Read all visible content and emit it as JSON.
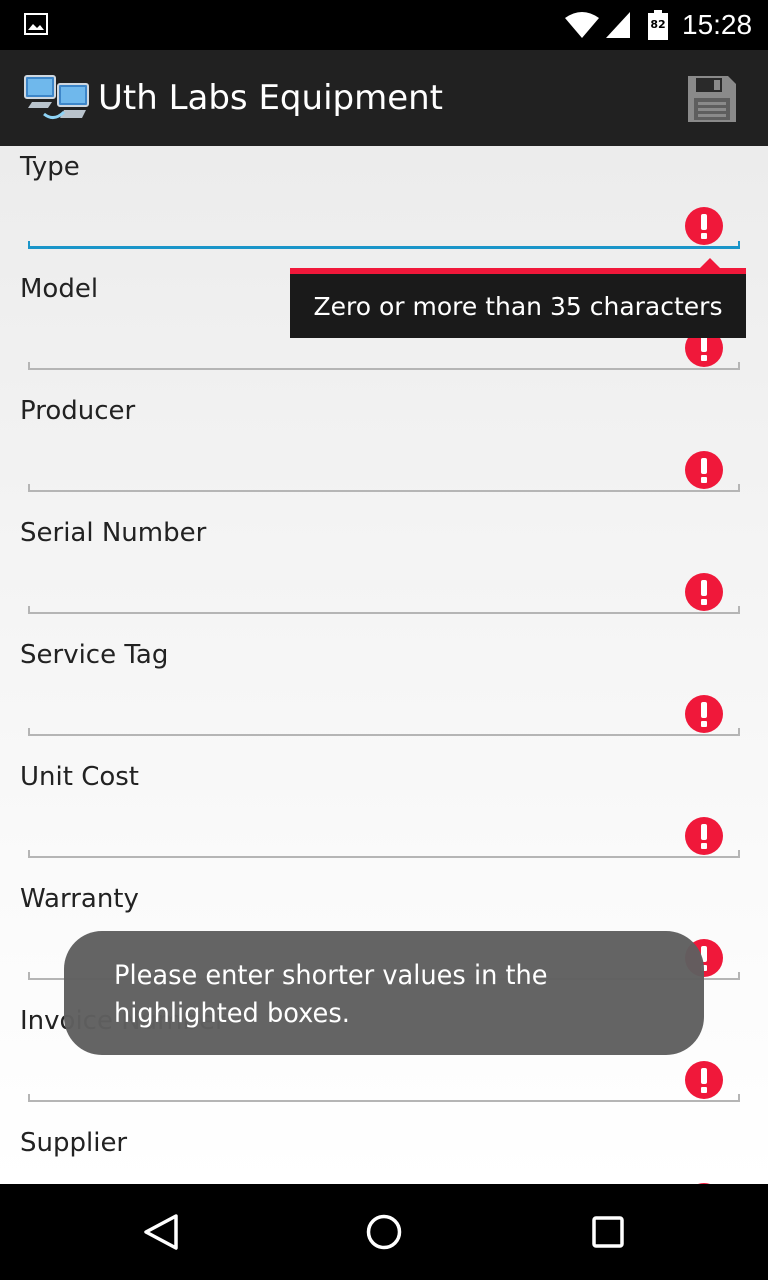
{
  "status_bar": {
    "time": "15:28",
    "battery_level": "82"
  },
  "action_bar": {
    "title": "Uth Labs Equipment",
    "save_icon": "save-icon"
  },
  "fields": [
    {
      "label": "Type"
    },
    {
      "label": "Model"
    },
    {
      "label": "Producer"
    },
    {
      "label": "Serial Number"
    },
    {
      "label": "Service Tag"
    },
    {
      "label": "Unit Cost"
    },
    {
      "label": "Warranty"
    },
    {
      "label": "Invoice Number"
    },
    {
      "label": "Supplier"
    }
  ],
  "error_tooltip": {
    "message": "Zero or more than 35 characters"
  },
  "toast": {
    "message": "Please enter shorter values in the highlighted boxes."
  },
  "colors": {
    "accent": "#1a95c9",
    "error": "#f0183a",
    "action_bar": "#212121"
  },
  "nav_bar": {
    "icons": [
      "back-icon",
      "home-icon",
      "recents-icon"
    ]
  }
}
